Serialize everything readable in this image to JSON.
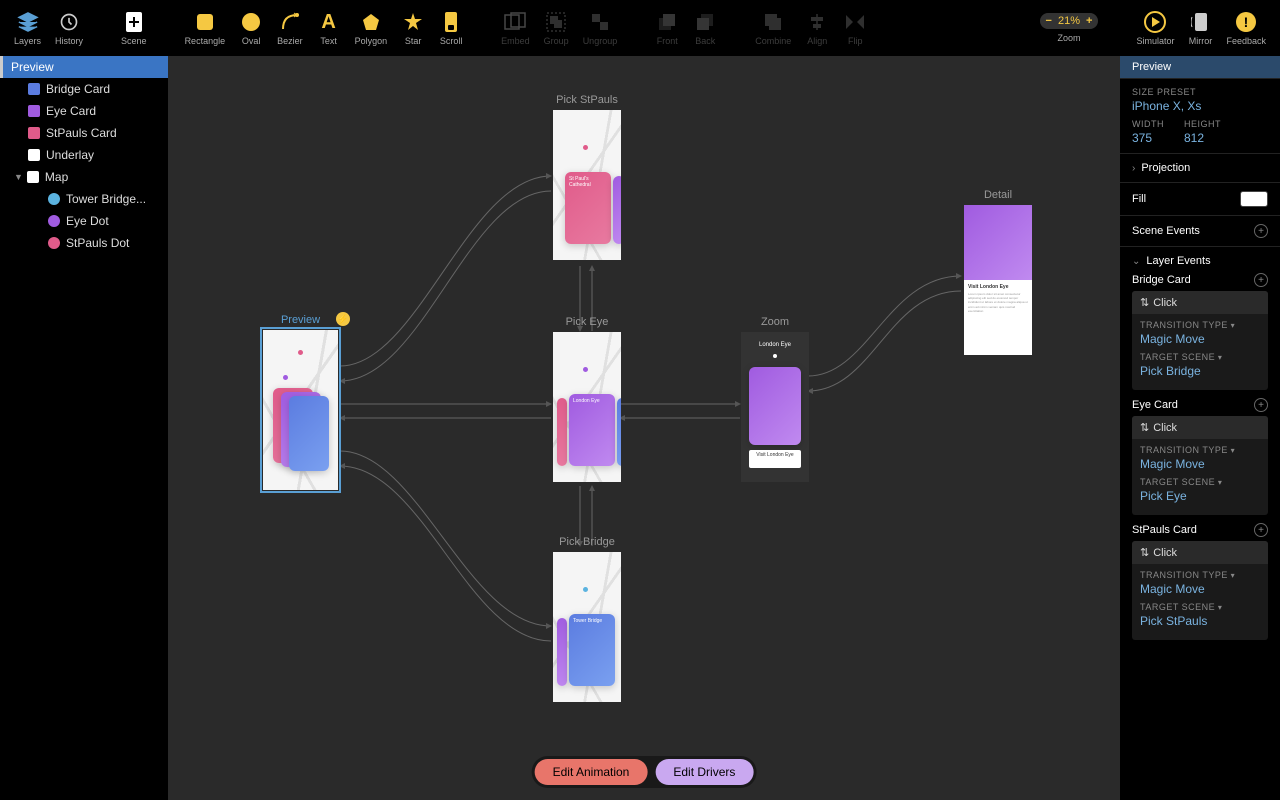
{
  "toolbar": {
    "tabs": {
      "layers": "Layers",
      "history": "History"
    },
    "scene": "Scene",
    "shapes": {
      "rect": "Rectangle",
      "oval": "Oval",
      "bezier": "Bezier",
      "text": "Text",
      "polygon": "Polygon",
      "star": "Star",
      "scroll": "Scroll"
    },
    "group": {
      "embed": "Embed",
      "group": "Group",
      "ungroup": "Ungroup"
    },
    "arrange": {
      "front": "Front",
      "back": "Back"
    },
    "ops": {
      "combine": "Combine",
      "align": "Align",
      "flip": "Flip"
    },
    "zoom": {
      "label": "Zoom",
      "value": "21%"
    },
    "right": {
      "simulator": "Simulator",
      "mirror": "Mirror",
      "feedback": "Feedback"
    }
  },
  "layers": [
    {
      "name": "Preview",
      "selected": true
    },
    {
      "name": "Bridge Card",
      "color": "#5b7ce0",
      "indent": 1
    },
    {
      "name": "Eye Card",
      "color": "#a05be0",
      "indent": 1
    },
    {
      "name": "StPauls Card",
      "color": "#e05b8a",
      "indent": 1
    },
    {
      "name": "Underlay",
      "color": "#fff",
      "indent": 1
    },
    {
      "name": "Map",
      "color": "#fff",
      "indent": 1,
      "expandable": true
    },
    {
      "name": "Tower Bridge...",
      "color": "#5bb3e0",
      "round": true,
      "indent": 2
    },
    {
      "name": "Eye Dot",
      "color": "#a05be0",
      "round": true,
      "indent": 2
    },
    {
      "name": "StPauls Dot",
      "color": "#e05b8a",
      "round": true,
      "indent": 2
    }
  ],
  "scenes": {
    "preview": "Preview",
    "pickStPauls": "Pick StPauls",
    "pickEye": "Pick Eye",
    "pickBridge": "Pick Bridge",
    "zoom": "Zoom",
    "detail": "Detail",
    "londonEye": "London Eye",
    "stPaulsCath": "St Paul's Cathedral",
    "towerBridge": "Tower Bridge",
    "visitLondonEye": "Visit London Eye"
  },
  "inspector": {
    "title": "Preview",
    "sizePreset": {
      "label": "SIZE PRESET",
      "value": "iPhone X, Xs"
    },
    "width": {
      "label": "WIDTH",
      "value": "375"
    },
    "height": {
      "label": "HEIGHT",
      "value": "812"
    },
    "projection": "Projection",
    "fill": "Fill",
    "sceneEvents": "Scene Events",
    "layerEvents": "Layer Events",
    "events": [
      {
        "layer": "Bridge Card",
        "trigger": "Click",
        "transitionType": {
          "label": "TRANSITION TYPE",
          "value": "Magic Move"
        },
        "targetScene": {
          "label": "TARGET SCENE",
          "value": "Pick Bridge"
        }
      },
      {
        "layer": "Eye Card",
        "trigger": "Click",
        "transitionType": {
          "label": "TRANSITION TYPE",
          "value": "Magic Move"
        },
        "targetScene": {
          "label": "TARGET SCENE",
          "value": "Pick Eye"
        }
      },
      {
        "layer": "StPauls Card",
        "trigger": "Click",
        "transitionType": {
          "label": "TRANSITION TYPE",
          "value": "Magic Move"
        },
        "targetScene": {
          "label": "TARGET SCENE",
          "value": "Pick StPauls"
        }
      }
    ]
  },
  "bottom": {
    "anim": "Edit Animation",
    "drivers": "Edit Drivers"
  }
}
